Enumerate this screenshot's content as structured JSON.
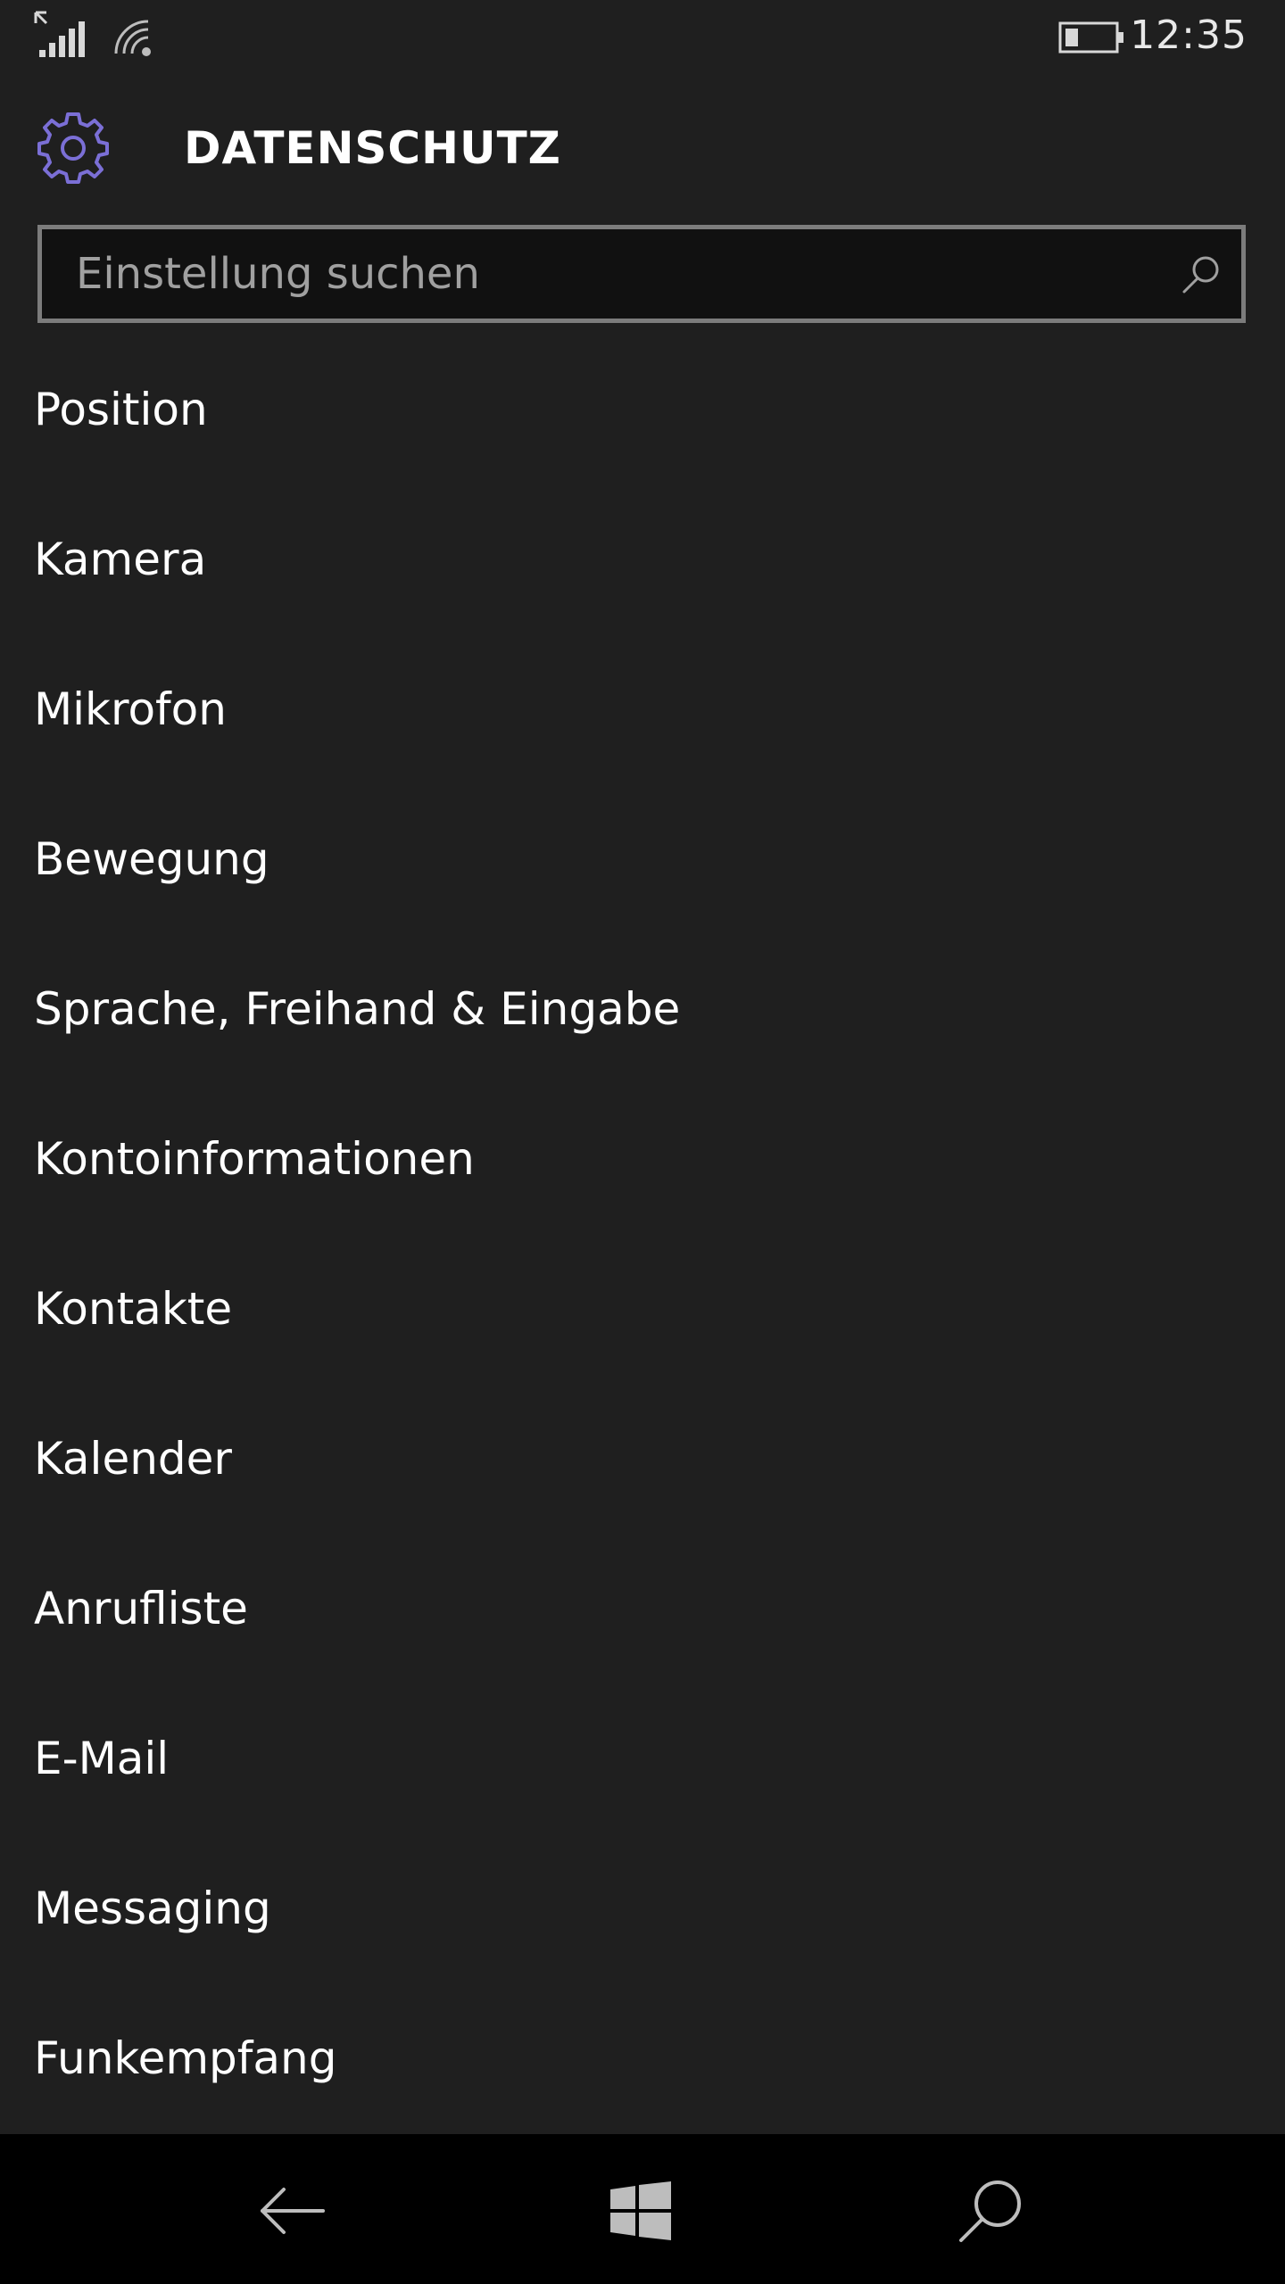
{
  "status_bar": {
    "time": "12:35",
    "icons": [
      "signal-icon",
      "wifi-icon",
      "battery-icon"
    ]
  },
  "header": {
    "title": "DATENSCHUTZ",
    "icon": "gear-icon",
    "icon_color": "#7b6fd6"
  },
  "search": {
    "placeholder": "Einstellung suchen",
    "value": ""
  },
  "list": {
    "items": [
      {
        "label": "Position"
      },
      {
        "label": "Kamera"
      },
      {
        "label": "Mikrofon"
      },
      {
        "label": "Bewegung"
      },
      {
        "label": "Sprache, Freihand & Eingabe"
      },
      {
        "label": "Kontoinformationen"
      },
      {
        "label": "Kontakte"
      },
      {
        "label": "Kalender"
      },
      {
        "label": "Anrufliste"
      },
      {
        "label": "E-Mail"
      },
      {
        "label": "Messaging"
      },
      {
        "label": "Funkempfang"
      }
    ]
  },
  "nav_bar": {
    "buttons": [
      "back-arrow-icon",
      "windows-logo-icon",
      "search-icon"
    ]
  },
  "colors": {
    "background": "#1f1f1f",
    "accent": "#7b6fd6",
    "nav_background": "#000000",
    "search_border": "#7c7c7c"
  }
}
